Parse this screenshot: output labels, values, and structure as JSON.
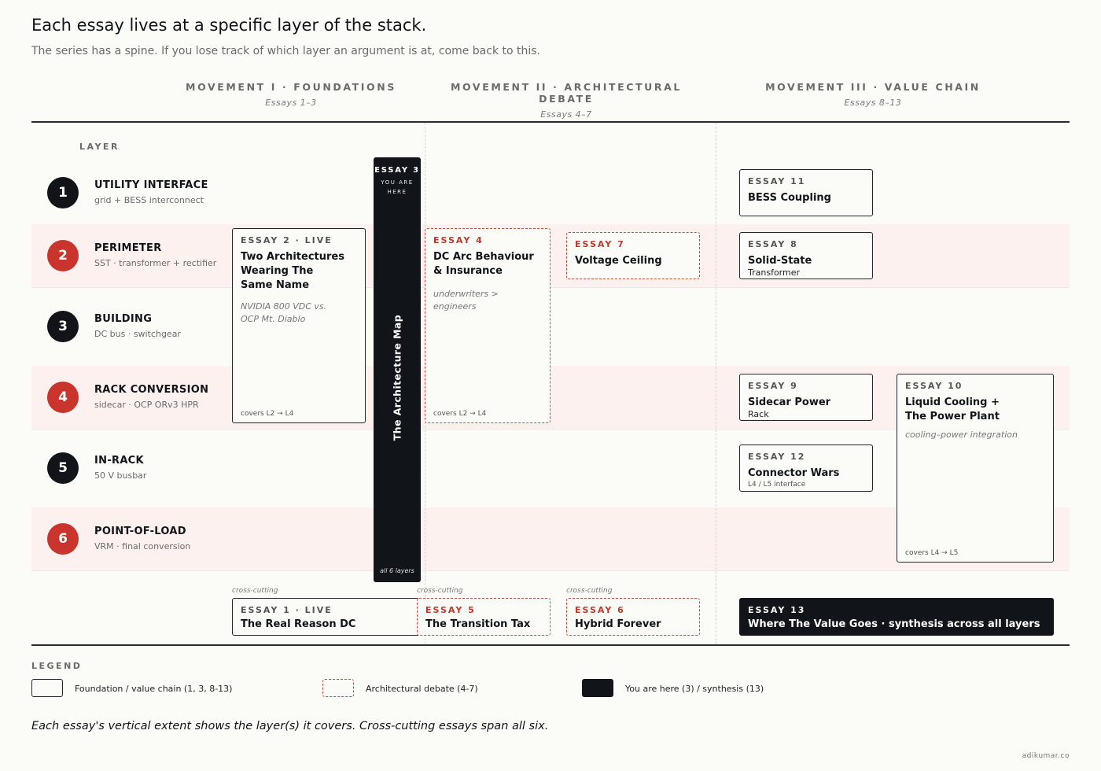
{
  "header": {
    "title": "Each essay lives at a specific layer of the stack.",
    "subtitle": "The series has a spine. If you lose track of which layer an argument is at, come back to this."
  },
  "movements": [
    {
      "name": "MOVEMENT I · FOUNDATIONS",
      "sub": "Essays 1–3"
    },
    {
      "name": "MOVEMENT II · ARCHITECTURAL DEBATE",
      "sub": "Essays 4–7"
    },
    {
      "name": "MOVEMENT III · VALUE CHAIN",
      "sub": "Essays 8–13"
    }
  ],
  "layer_header": "LAYER",
  "layers": [
    {
      "num": "1",
      "name": "UTILITY INTERFACE",
      "desc": "grid + BESS interconnect",
      "color": "#111418"
    },
    {
      "num": "2",
      "name": "PERIMETER",
      "desc": "SST · transformer + rectifier",
      "color": "#c9342c"
    },
    {
      "num": "3",
      "name": "BUILDING",
      "desc": "DC bus · switchgear",
      "color": "#111418"
    },
    {
      "num": "4",
      "name": "RACK CONVERSION",
      "desc": "sidecar · OCP ORv3 HPR",
      "color": "#c9342c"
    },
    {
      "num": "5",
      "name": "IN-RACK",
      "desc": "50 V busbar",
      "color": "#111418"
    },
    {
      "num": "6",
      "name": "POINT-OF-LOAD",
      "desc": "VRM · final conversion",
      "color": "#c9342c"
    }
  ],
  "essays": {
    "e2": {
      "eyebrow": "ESSAY 2 · LIVE",
      "title_lines": [
        "Two Architectures",
        "Wearing The",
        "Same Name"
      ],
      "note_lines": [
        "NVIDIA 800 VDC vs.",
        "OCP Mt. Diablo"
      ],
      "covers": "covers L2 → L4"
    },
    "e3": {
      "eyebrow": "ESSAY 3",
      "here_lines": [
        "YOU ARE",
        "HERE"
      ],
      "title": "The Architecture Map",
      "foot": "all 6 layers"
    },
    "e4": {
      "eyebrow": "ESSAY 4",
      "title_lines": [
        "DC Arc Behaviour",
        "& Insurance"
      ],
      "note": "underwriters > engineers",
      "covers": "covers L2 → L4"
    },
    "e7": {
      "eyebrow": "ESSAY 7",
      "title": "Voltage Ceiling"
    },
    "e11": {
      "eyebrow": "ESSAY 11",
      "title": "BESS Coupling"
    },
    "e8": {
      "eyebrow": "ESSAY 8",
      "title": "Solid-State",
      "sub": "Transformer"
    },
    "e9": {
      "eyebrow": "ESSAY 9",
      "title": "Sidecar Power",
      "sub": "Rack"
    },
    "e12": {
      "eyebrow": "ESSAY 12",
      "title": "Connector Wars",
      "sub": "L4 / L5 interface"
    },
    "e10": {
      "eyebrow": "ESSAY 10",
      "title_lines": [
        "Liquid Cooling +",
        "The Power Plant"
      ],
      "note": "cooling–power integration",
      "covers": "covers L4 → L5"
    },
    "e1": {
      "tag": "cross-cutting",
      "eyebrow": "ESSAY 1 · LIVE",
      "title": "The Real Reason DC"
    },
    "e5": {
      "tag": "cross-cutting",
      "eyebrow": "ESSAY 5",
      "title": "The Transition Tax"
    },
    "e6": {
      "tag": "cross-cutting",
      "eyebrow": "ESSAY 6",
      "title": "Hybrid Forever"
    },
    "e13": {
      "eyebrow": "ESSAY 13",
      "title": "Where The Value Goes · synthesis across all layers"
    }
  },
  "legend": {
    "header": "LEGEND",
    "items": [
      {
        "label": "Foundation / value chain (1, 3, 8-13)",
        "style": "solid"
      },
      {
        "label": "Architectural debate (4-7)",
        "style": "dashed"
      },
      {
        "label": "You are here (3) / synthesis (13)",
        "style": "dark"
      }
    ]
  },
  "footnote": "Each essay's vertical extent shows the layer(s) it covers. Cross-cutting essays span all six.",
  "credit": "adikumar.co",
  "colors": {
    "accent_red": "#c9342c",
    "dark": "#111418",
    "band_tint": "#fdf1f0"
  }
}
